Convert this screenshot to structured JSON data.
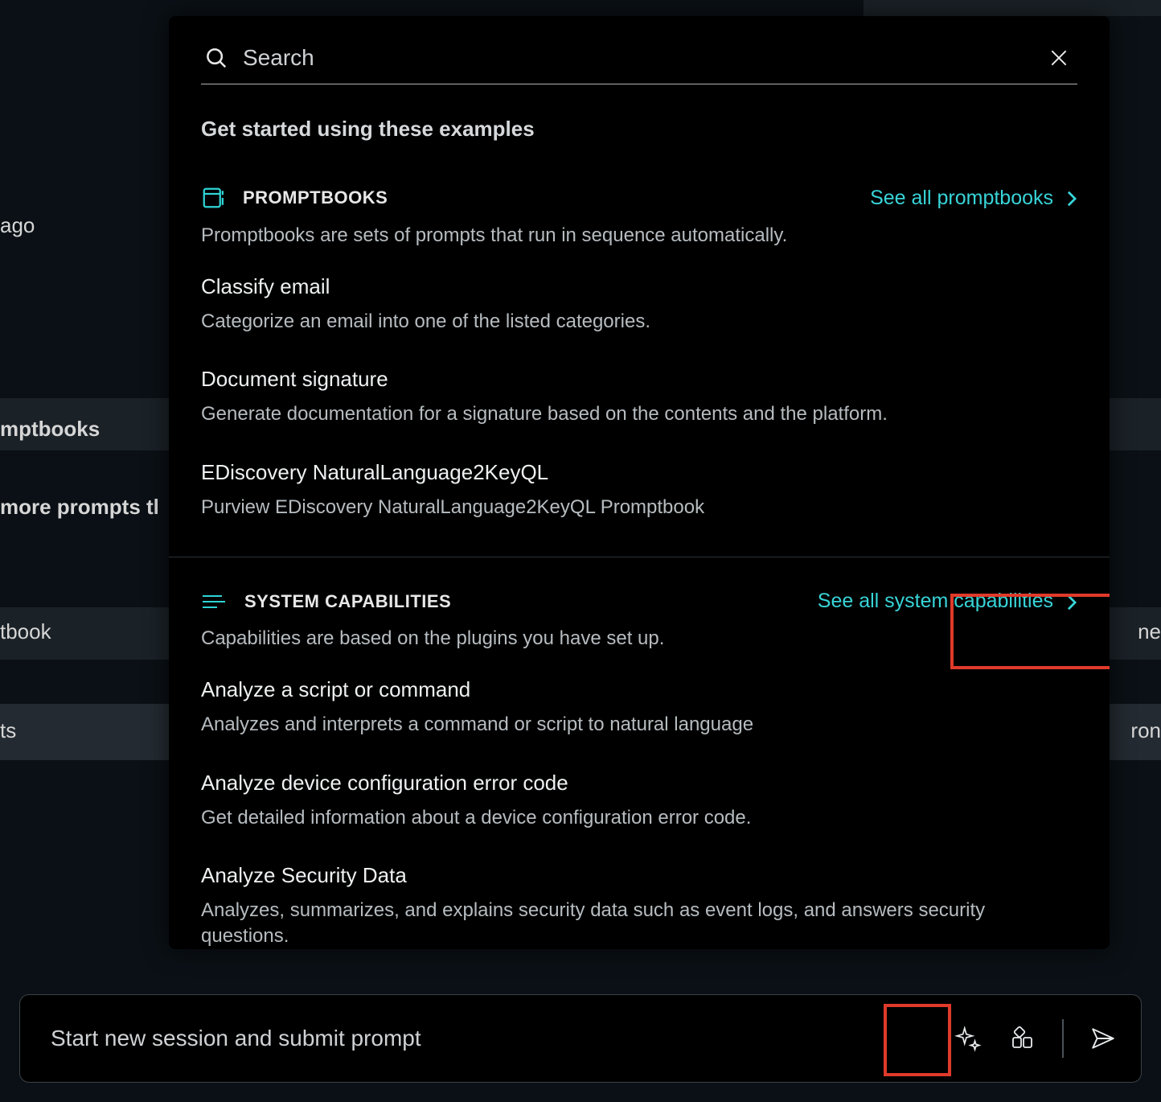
{
  "background": {
    "ago": "ago",
    "mptbooks": "mptbooks",
    "more_prompts": " more prompts tl",
    "tbook": "tbook",
    "ts": "ts",
    "ne": "ne",
    "ron": "ron"
  },
  "search": {
    "placeholder": "Search"
  },
  "intro": "Get started using these examples",
  "promptbooks": {
    "label": "PROMPTBOOKS",
    "see_all": "See all promptbooks",
    "desc": "Promptbooks are sets of prompts that run in sequence automatically.",
    "items": [
      {
        "title": "Classify email",
        "desc": "Categorize an email into one of the listed categories."
      },
      {
        "title": "Document signature",
        "desc": "Generate documentation for a signature based on the contents and the platform."
      },
      {
        "title": "EDiscovery NaturalLanguage2KeyQL",
        "desc": "Purview EDiscovery NaturalLanguage2KeyQL Promptbook"
      }
    ]
  },
  "capabilities": {
    "label": "SYSTEM CAPABILITIES",
    "see_all": "See all system capabilities",
    "desc": "Capabilities are based on the plugins you have set up.",
    "items": [
      {
        "title": "Analyze a script or command",
        "desc": "Analyzes and interprets a command or script to natural language"
      },
      {
        "title": "Analyze device configuration error code",
        "desc": "Get detailed information about a device configuration error code."
      },
      {
        "title": "Analyze Security Data",
        "desc": "Analyzes, summarizes, and explains security data such as event logs, and answers security questions."
      }
    ]
  },
  "prompt_bar": {
    "placeholder": "Start new session and submit prompt"
  },
  "colors": {
    "accent": "#38d4d8",
    "highlight": "#e03a2a"
  }
}
